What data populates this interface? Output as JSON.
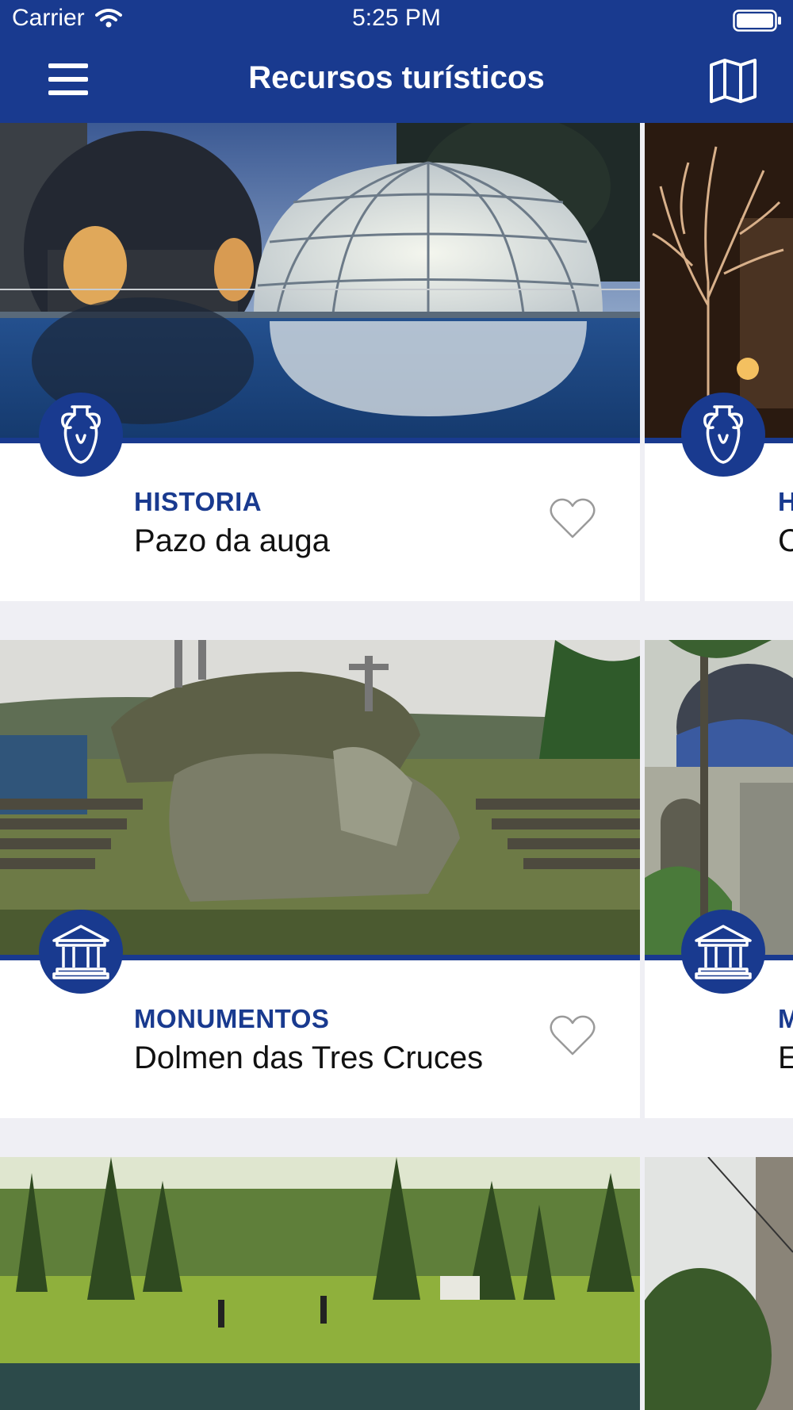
{
  "status_bar": {
    "carrier": "Carrier",
    "time": "5:25 PM"
  },
  "header": {
    "title": "Recursos turísticos"
  },
  "cards": [
    {
      "category": "HISTORIA",
      "name": "Pazo da auga",
      "category_icon": "amphora-icon"
    },
    {
      "category": "H",
      "name": "C",
      "category_icon": "amphora-icon"
    },
    {
      "category": "MONUMENTOS",
      "name": "Dolmen das Tres Cruces",
      "category_icon": "museum-icon"
    },
    {
      "category": "M",
      "name": "E",
      "category_icon": "museum-icon"
    }
  ],
  "colors": {
    "primary": "#193a8f",
    "background": "#efeff4",
    "card": "#ffffff"
  }
}
